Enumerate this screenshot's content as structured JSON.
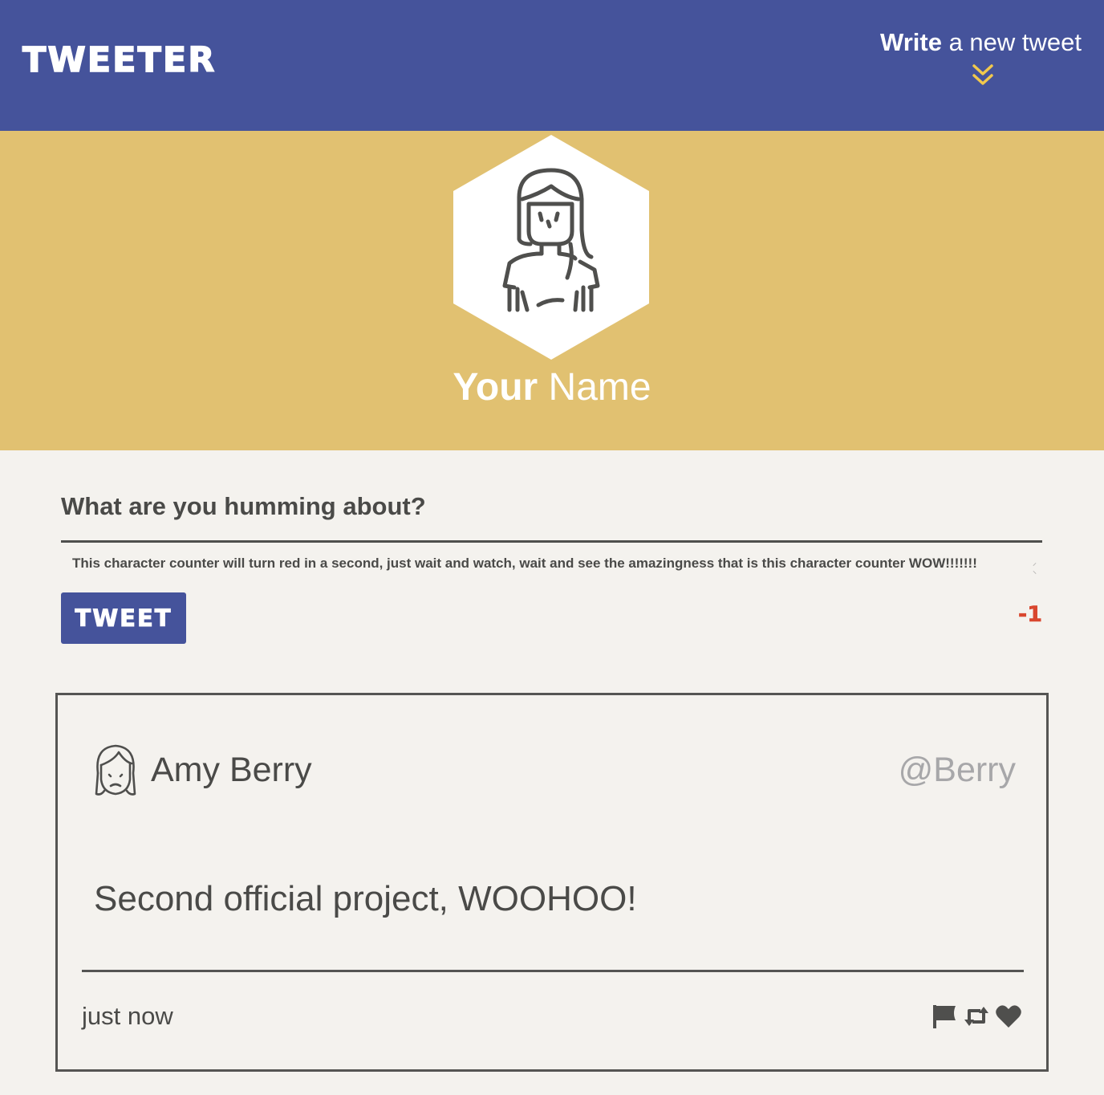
{
  "nav": {
    "brand": "TWEETER",
    "compose_bold": "Write",
    "compose_rest": " a new tweet",
    "chevron_icon": "double-chevron-down-icon",
    "background": "#45539b",
    "accent": "#f1c84d"
  },
  "profile": {
    "name_bold": "Your",
    "name_rest": " Name",
    "avatar_icon": "user-avatar-icon",
    "background": "#e1c171"
  },
  "compose": {
    "prompt": "What are you humming about?",
    "text": "This character counter will turn red in a second, just wait and watch, wait and see the amazingness that is this character counter WOW!!!!!!!",
    "submit_label": "TWEET",
    "counter": "-1",
    "counter_color": "#d9472f"
  },
  "tweets": [
    {
      "author": "Amy Berry",
      "handle": "@Berry",
      "content": "Second official project, WOOHOO!",
      "time": "just now",
      "avatar_icon": "user-avatar-icon",
      "actions": [
        "flag-icon",
        "retweet-icon",
        "heart-icon"
      ]
    }
  ]
}
